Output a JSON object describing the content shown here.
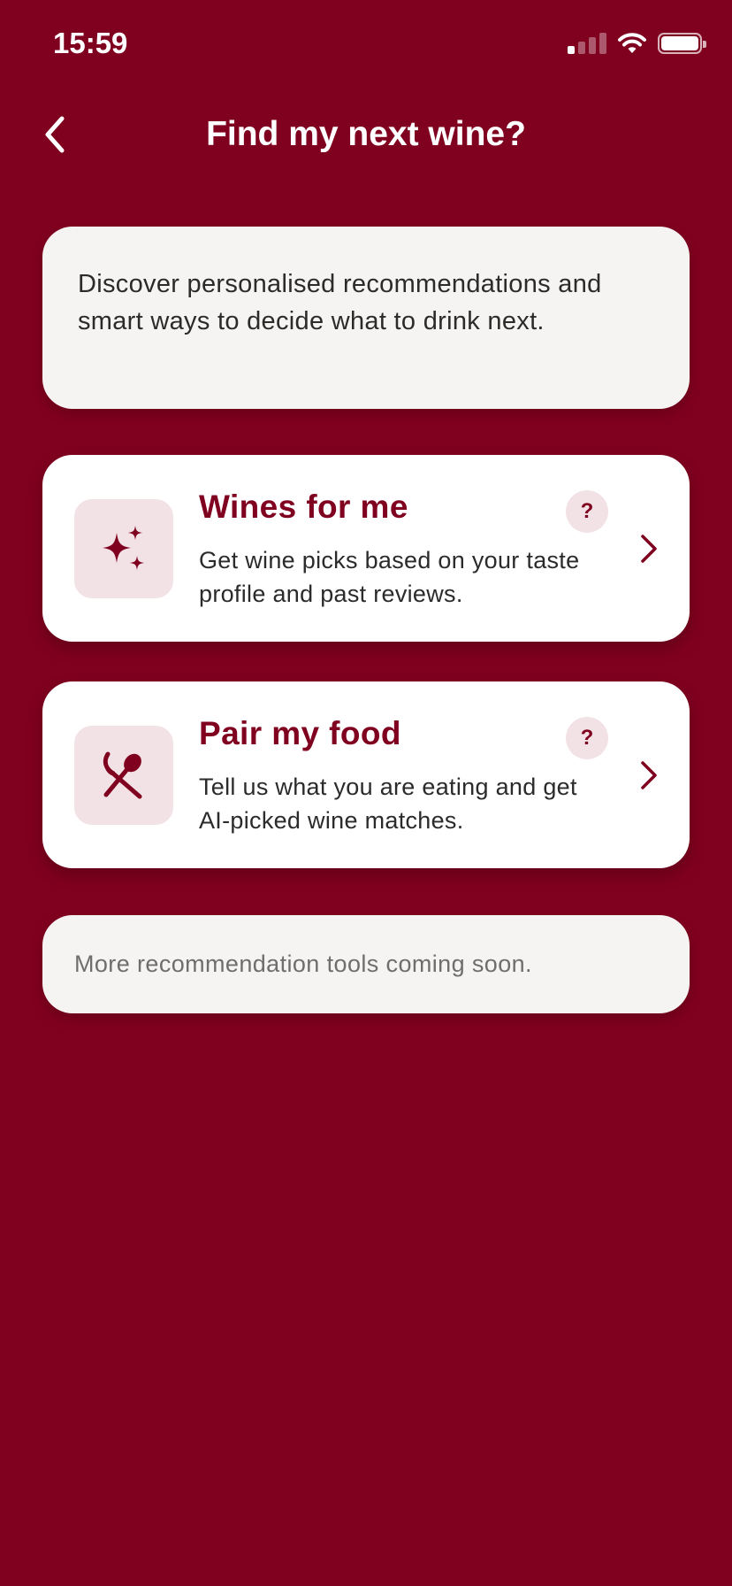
{
  "status_bar": {
    "time": "15:59",
    "signal_bars_active": 1,
    "signal_bars_total": 4,
    "battery_level": 1.0
  },
  "header": {
    "title": "Find my next wine?",
    "back_icon": "chevron-left-icon"
  },
  "intro": {
    "text": "Discover personalised recommendations and smart ways to decide what to drink next."
  },
  "options": [
    {
      "icon": "sparkles-icon",
      "title": "Wines for me",
      "description": "Get wine picks based on your taste profile and past reviews.",
      "help_label": "?"
    },
    {
      "icon": "fork-spoon-icon",
      "title": "Pair my food",
      "description": "Tell us what you are eating and get AI-picked wine matches.",
      "help_label": "?"
    }
  ],
  "coming_soon": {
    "text": "More recommendation tools coming soon."
  },
  "colors": {
    "background": "#80001F",
    "brand": "#80001F",
    "card_light": "#F6F4F2",
    "icon_tile": "#F2E2E5"
  }
}
